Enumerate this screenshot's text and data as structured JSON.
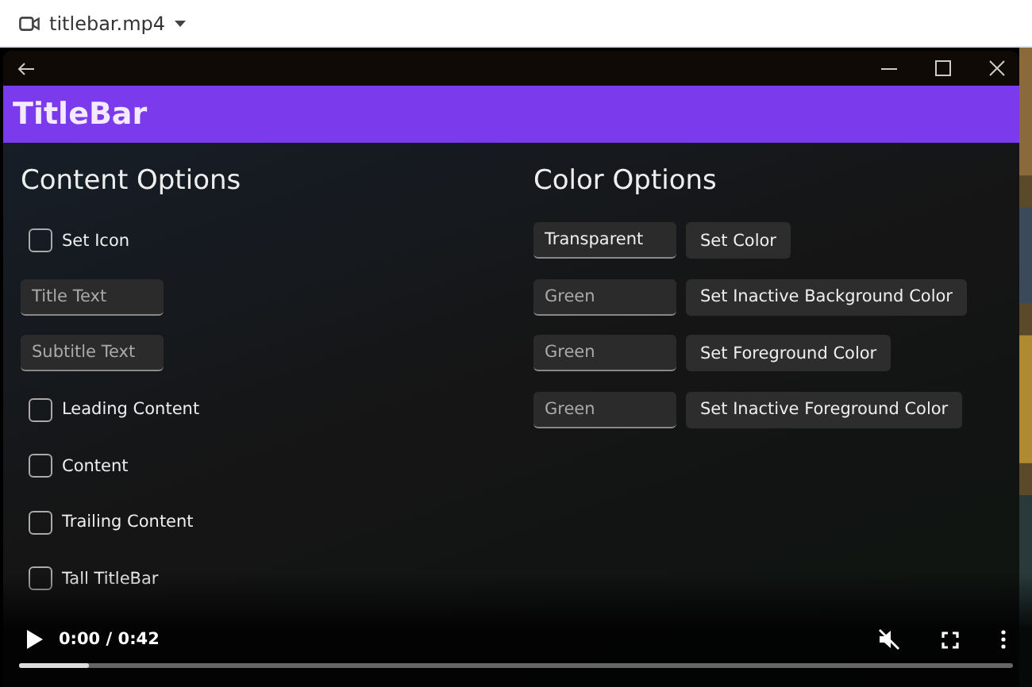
{
  "file_bar": {
    "file_name": "titlebar.mp4"
  },
  "video": {
    "app_window": {
      "title": "TitleBar",
      "content_options": {
        "heading": "Content Options",
        "items": [
          {
            "kind": "checkbox",
            "label": "Set Icon",
            "checked": false
          },
          {
            "kind": "field",
            "placeholder": "Title Text"
          },
          {
            "kind": "field",
            "placeholder": "Subtitle Text"
          },
          {
            "kind": "checkbox",
            "label": "Leading Content",
            "checked": false
          },
          {
            "kind": "checkbox",
            "label": "Content",
            "checked": false
          },
          {
            "kind": "checkbox",
            "label": "Trailing Content",
            "checked": false
          },
          {
            "kind": "checkbox",
            "label": "Tall TitleBar",
            "checked": false
          }
        ]
      },
      "color_options": {
        "heading": "Color Options",
        "rows": [
          {
            "value": "Transparent",
            "button": "Set Color"
          },
          {
            "placeholder": "Green",
            "button": "Set Inactive Background Color"
          },
          {
            "placeholder": "Green",
            "button": "Set Foreground Color"
          },
          {
            "placeholder": "Green",
            "button": "Set Inactive Foreground Color"
          }
        ]
      }
    },
    "controls": {
      "time": "0:00 / 0:42",
      "muted": true,
      "level": 0.07
    }
  }
}
